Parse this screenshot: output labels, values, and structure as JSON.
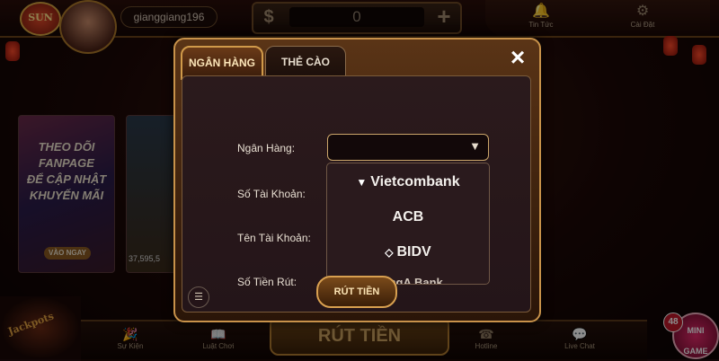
{
  "header": {
    "logo_text": "SUN",
    "username": "gianggiang196",
    "currency_icon": "dollar-icon",
    "balance": "0",
    "plus_icon": "plus-icon",
    "news_label": "Tin Tức",
    "settings_label": "Cài Đặt"
  },
  "promo": {
    "lines": [
      "THEO DÕI",
      "FANPAGE",
      "ĐỂ CẬP NHẬT",
      "KHUYẾN MÃI"
    ],
    "button": "VÀO NGAY",
    "game_label": "37,595,5"
  },
  "modal": {
    "tabs": [
      {
        "label": "NGÂN HÀNG",
        "active": true
      },
      {
        "label": "THẺ CÀO",
        "active": false
      }
    ],
    "close_icon": "×",
    "fields": {
      "bank": "Ngân Hàng:",
      "account_number": "Số Tài Khoản:",
      "account_name": "Tên Tài Khoản:",
      "amount": "Số Tiền Rút:"
    },
    "dropdown": {
      "selected": "",
      "arrow": "▼",
      "options": [
        "Vietcombank",
        "ACB",
        "BIDV",
        "DongA Bank"
      ]
    },
    "submit": "RÚT TIỀN"
  },
  "bottom": {
    "items": [
      "Sự Kiện",
      "Luật Chơi",
      "Hotline",
      "Live Chat"
    ],
    "big_button": "RÚT TIỀN"
  },
  "minigame": {
    "label_line1": "MINI",
    "label_line2": "GAME",
    "badge": "48"
  },
  "colors": {
    "gold": "#c8924a",
    "background": "#1a0806",
    "modal_inner": "#2b1a1c"
  }
}
